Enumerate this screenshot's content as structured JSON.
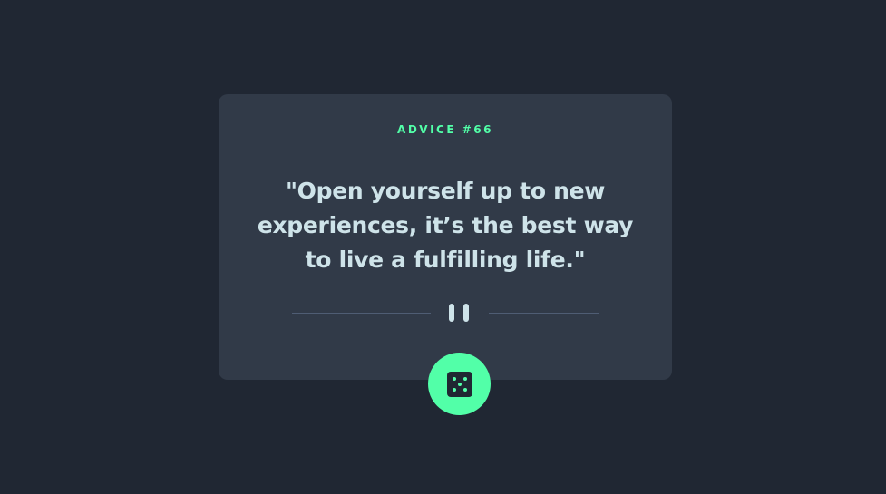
{
  "card": {
    "advice_label": "ADVICE #66",
    "quote": "\"Open yourself up to new experiences, it’s the best way to live a fulfilling life.\""
  },
  "divider": {
    "icon": "pause-icon"
  },
  "dice_button": {
    "icon": "dice-icon"
  },
  "colors": {
    "background": "#202733",
    "card": "#313a48",
    "accent": "#52ffa8",
    "text": "#cee3e9",
    "divider": "#4f5d74"
  }
}
